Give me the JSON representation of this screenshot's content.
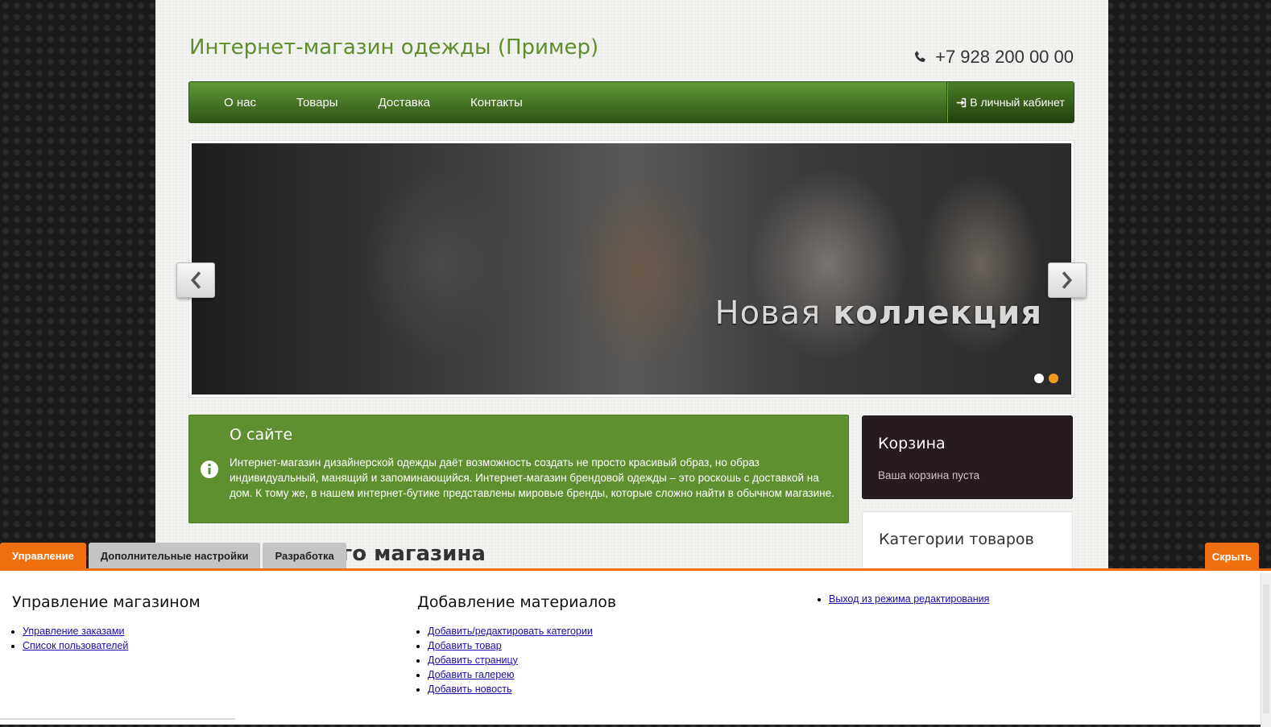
{
  "header": {
    "site_title": "Интернет-магазин одежды (Пример)",
    "phone": "+7 928 200 00 00"
  },
  "nav": {
    "items": [
      "О нас",
      "Товары",
      "Доставка",
      "Контакты"
    ],
    "cabinet_label": "В личный кабинет"
  },
  "slider": {
    "caption_light": "Новая",
    "caption_bold": "коллекция",
    "slides_total": 2,
    "active_slide": 2
  },
  "about": {
    "title": "О сайте",
    "text": "Интернет-магазин дизайнерской одежды даёт возможность создать не просто красивый образ, но образ индивидуальный, манящий и запоминающийся. Интернет-магазин брендовой одежды – это роскошь с доставкой на дом. К тому же, в нашем интернет-бутике представлены мировые бренды, которые сложно найти в обычном магазине."
  },
  "cart": {
    "title": "Корзина",
    "empty_text": "Ваша корзина пуста"
  },
  "categories": {
    "title": "Категории товаров"
  },
  "partial_heading": "его магазина",
  "admin": {
    "tabs": [
      "Управление",
      "Дополнительные настройки",
      "Разработка"
    ],
    "hide_label": "Скрыть",
    "col1": {
      "title": "Управление магазином",
      "links": [
        "Управление заказами",
        "Список пользователей"
      ]
    },
    "col2": {
      "title": "Добавление материалов",
      "links": [
        "Добавить/редактировать категории",
        "Добавить товар",
        "Добавить страницу",
        "Добавить галерею",
        "Добавить новость"
      ]
    },
    "col3": {
      "links": [
        "Выход из режима редактирования"
      ]
    }
  },
  "colors": {
    "brand_green": "#5e902f",
    "accent_orange": "#f26f0f",
    "cart_bg": "#271a20"
  }
}
